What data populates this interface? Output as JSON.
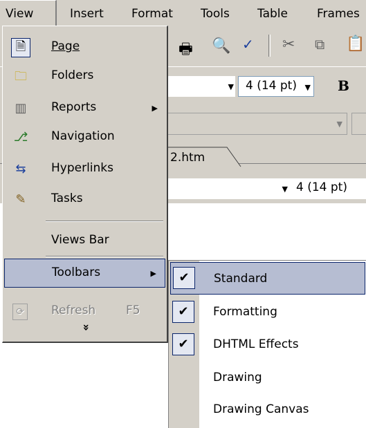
{
  "menubar": {
    "items": [
      {
        "label": "View"
      },
      {
        "label": "Insert"
      },
      {
        "label": "Format"
      },
      {
        "label": "Tools"
      },
      {
        "label": "Table"
      },
      {
        "label": "Frames"
      }
    ]
  },
  "toolbar": {
    "font_size_combo": "4 (14 pt)",
    "bold_label": "B",
    "doc_tab": "2.htm",
    "font_size_combo2": "4 (14 pt)"
  },
  "view_menu": {
    "items": [
      {
        "label": "Page",
        "icon": "page-icon"
      },
      {
        "label": "Folders",
        "icon": "folder-icon"
      },
      {
        "label": "Reports",
        "icon": "reports-icon"
      },
      {
        "label": "Navigation",
        "icon": "navigation-icon"
      },
      {
        "label": "Hyperlinks",
        "icon": "hyperlinks-icon"
      },
      {
        "label": "Tasks",
        "icon": "tasks-icon"
      },
      {
        "label": "Views Bar"
      },
      {
        "label": "Toolbars"
      },
      {
        "label": "Refresh",
        "shortcut": "F5",
        "icon": "refresh-icon"
      },
      {
        "label": "»"
      }
    ]
  },
  "toolbars_submenu": {
    "items": [
      {
        "label": "Standard",
        "checked": true
      },
      {
        "label": "Formatting",
        "checked": true
      },
      {
        "label": "DHTML Effects",
        "checked": true
      },
      {
        "label": "Drawing",
        "checked": false
      },
      {
        "label": "Drawing Canvas",
        "checked": false
      }
    ],
    "check_glyph": "✔"
  },
  "colors": {
    "highlight": "#b6bdd2",
    "highlight_border": "#0a246a",
    "menu_bg": "#d4d0c8"
  }
}
